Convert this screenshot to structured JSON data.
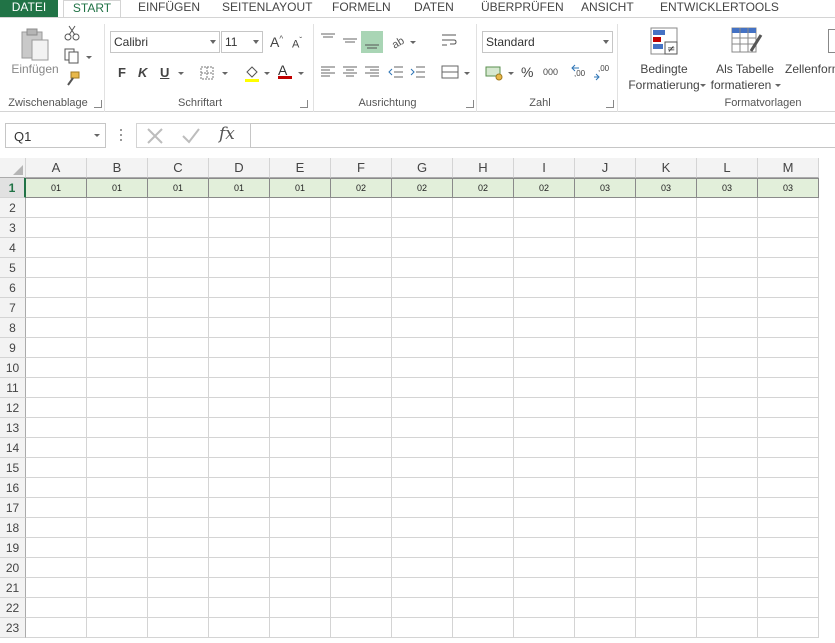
{
  "tabs": [
    {
      "label": "DATEI"
    },
    {
      "label": "START"
    },
    {
      "label": "EINFÜGEN"
    },
    {
      "label": "SEITENLAYOUT"
    },
    {
      "label": "FORMELN"
    },
    {
      "label": "DATEN"
    },
    {
      "label": "ÜBERPRÜFEN"
    },
    {
      "label": "ANSICHT"
    },
    {
      "label": "ENTWICKLERTOOLS"
    }
  ],
  "ribbon": {
    "clipboard": {
      "paste_label": "Einfügen",
      "group_label": "Zwischenablage"
    },
    "font": {
      "font_name": "Calibri",
      "font_size": "11",
      "bold": "F",
      "italic": "K",
      "underline": "U",
      "group_label": "Schriftart"
    },
    "alignment": {
      "group_label": "Ausrichtung"
    },
    "number": {
      "format": "Standard",
      "percent": "%",
      "thousands": "000",
      "inc_decimal": ",00",
      "dec_decimal": ",00",
      "group_label": "Zahl"
    },
    "styles": {
      "conditional_line1": "Bedingte",
      "conditional_line2": "Formatierung",
      "table_line1": "Als Tabelle",
      "table_line2": "formatieren",
      "cell_styles": "Zellenform",
      "group_label": "Formatvorlagen"
    }
  },
  "formula_bar": {
    "name_box": "Q1",
    "fx": "fx",
    "formula": ""
  },
  "columns": [
    "A",
    "B",
    "C",
    "D",
    "E",
    "F",
    "G",
    "H",
    "I",
    "J",
    "K",
    "L",
    "M"
  ],
  "rows": [
    "1",
    "2",
    "3",
    "4",
    "5",
    "6",
    "7",
    "8",
    "9",
    "10",
    "11",
    "12",
    "13",
    "14",
    "15",
    "16",
    "17",
    "18",
    "19",
    "20",
    "21",
    "22",
    "23"
  ],
  "row1_values": [
    "01",
    "01",
    "01",
    "01",
    "01",
    "02",
    "02",
    "02",
    "02",
    "03",
    "03",
    "03",
    "03"
  ],
  "colors": {
    "excel_green": "#217346",
    "row1_fill": "#e2efda"
  }
}
